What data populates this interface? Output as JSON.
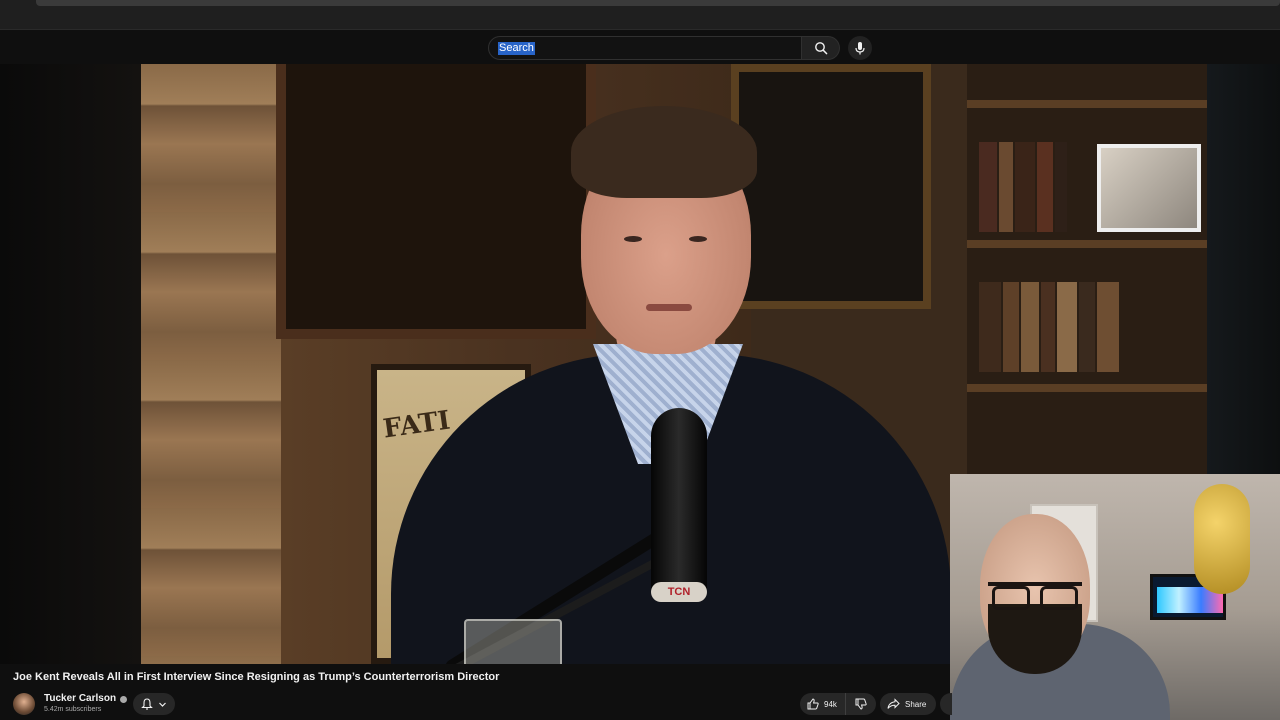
{
  "search": {
    "query": "Search"
  },
  "video": {
    "title": "Joe Kent Reveals All in First Interview Since Resigning as Trump’s Counterterrorism Director",
    "mic_badge": "TCN",
    "poster_text": "FATI"
  },
  "channel": {
    "name": "Tucker Carlson",
    "subscribers": "5.42m subscribers",
    "verified": true
  },
  "actions": {
    "like_count": "94k",
    "share_label": "Share"
  },
  "icons": {
    "search": "search-icon",
    "mic": "microphone-icon",
    "bell": "bell-icon",
    "chevron": "chevron-down-icon",
    "like": "thumbs-up-icon",
    "dislike": "thumbs-down-icon",
    "share": "share-arrow-icon"
  },
  "colors": {
    "background": "#0f0f0f",
    "selection_highlight": "#2864c8",
    "button_bg": "#272727",
    "text_primary": "#f1f1f1",
    "text_secondary": "#aaaaaa"
  }
}
